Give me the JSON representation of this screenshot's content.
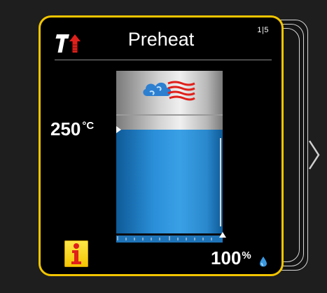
{
  "card": {
    "title": "Preheat",
    "page_indicator": "1|5",
    "mode_icon": "temperature-rising-icon"
  },
  "temperature": {
    "value": "250",
    "unit": "°C"
  },
  "gauge": {
    "icon": "convection-fan-icon",
    "fill_fraction": 0.65,
    "setpoint_fraction": 0.65,
    "fill_color": "#2a8fd8"
  },
  "humidity": {
    "value": "100",
    "unit": "%",
    "icon": "water-drop-icon",
    "level_fraction": 1.0
  },
  "info": {
    "icon": "info-icon",
    "color": "#f4c400"
  },
  "navigation": {
    "next_icon": "chevron-right-icon"
  },
  "colors": {
    "card_border": "#f2c500",
    "accent_red": "#e0201b"
  }
}
